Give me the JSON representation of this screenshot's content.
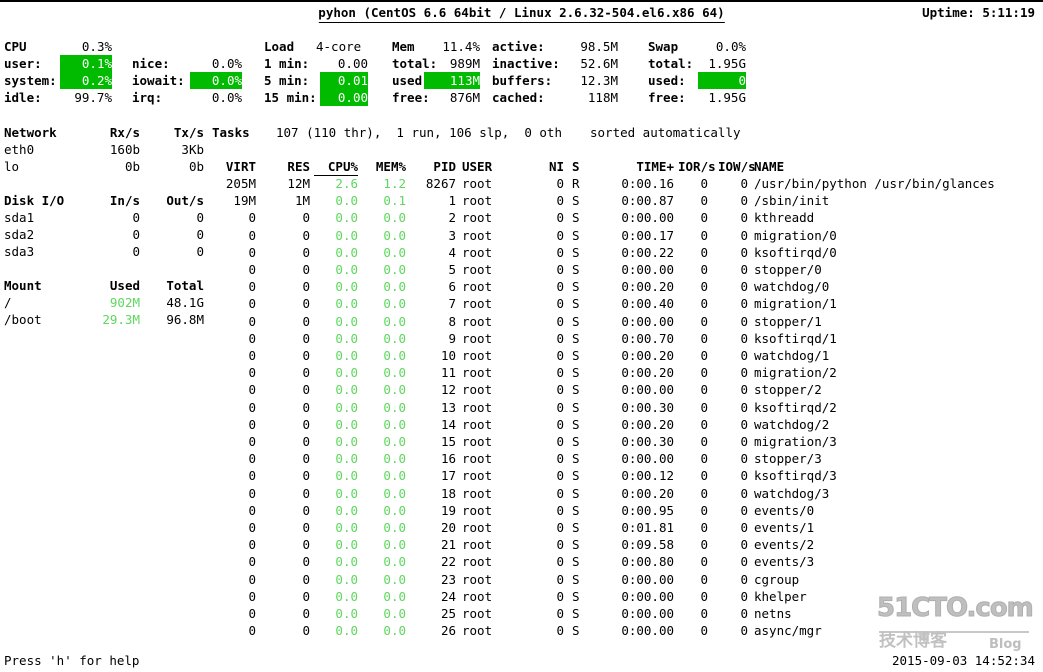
{
  "header": {
    "title": "pyhon (CentOS 6.6 64bit / Linux 2.6.32-504.el6.x86 64)",
    "uptime_label": "Uptime: 5:11:19"
  },
  "cpu": {
    "title": "CPU",
    "total": "0.3%",
    "rows": [
      {
        "label": "user:",
        "value": "0.1%",
        "highlight": true
      },
      {
        "label": "system:",
        "value": "0.2%",
        "highlight": true
      },
      {
        "label": "idle:",
        "value": "99.7%",
        "highlight": false
      }
    ],
    "rows2": [
      {
        "label": "nice:",
        "value": "0.0%",
        "highlight": false
      },
      {
        "label": "iowait:",
        "value": "0.0%",
        "highlight": true
      },
      {
        "label": "irq:",
        "value": "0.0%",
        "highlight": false
      }
    ]
  },
  "load": {
    "title": "Load",
    "cores": "4-core",
    "rows": [
      {
        "label": "1 min:",
        "value": "0.00",
        "highlight": false
      },
      {
        "label": "5 min:",
        "value": "0.01",
        "highlight": true
      },
      {
        "label": "15 min:",
        "value": "0.00",
        "highlight": true
      }
    ]
  },
  "mem": {
    "title": "Mem",
    "percent": "11.4%",
    "rows": [
      {
        "label": "total:",
        "value": "989M",
        "highlight": false
      },
      {
        "label": "used:",
        "value": "113M",
        "highlight": true
      },
      {
        "label": "free:",
        "value": "876M",
        "highlight": false
      }
    ],
    "rows2": [
      {
        "label": "active:",
        "value": "98.5M",
        "highlight": false
      },
      {
        "label": "inactive:",
        "value": "52.6M",
        "highlight": false
      },
      {
        "label": "buffers:",
        "value": "12.3M",
        "highlight": false
      },
      {
        "label": "cached:",
        "value": "118M",
        "highlight": false
      }
    ]
  },
  "swap": {
    "title": "Swap",
    "percent": "0.0%",
    "rows": [
      {
        "label": "total:",
        "value": "1.95G",
        "highlight": false
      },
      {
        "label": "used:",
        "value": "0",
        "highlight": true
      },
      {
        "label": "free:",
        "value": "1.95G",
        "highlight": false
      }
    ]
  },
  "network": {
    "title": "Network",
    "col_rx": "Rx/s",
    "col_tx": "Tx/s",
    "rows": [
      {
        "name": "eth0",
        "rx": "160b",
        "tx": "3Kb"
      },
      {
        "name": "lo",
        "rx": "0b",
        "tx": "0b"
      }
    ]
  },
  "diskio": {
    "title": "Disk I/O",
    "col_in": "In/s",
    "col_out": "Out/s",
    "rows": [
      {
        "name": "sda1",
        "in": "0",
        "out": "0"
      },
      {
        "name": "sda2",
        "in": "0",
        "out": "0"
      },
      {
        "name": "sda3",
        "in": "0",
        "out": "0"
      }
    ]
  },
  "mount": {
    "title": "Mount",
    "col_used": "Used",
    "col_total": "Total",
    "rows": [
      {
        "name": "/",
        "used": "902M",
        "total": "48.1G"
      },
      {
        "name": "/boot",
        "used": "29.3M",
        "total": "96.8M"
      }
    ]
  },
  "tasks": {
    "title": "Tasks",
    "summary": "107 (110 thr),  1 run, 106 slp,  0 oth",
    "sort_note": "sorted automatically"
  },
  "process_table": {
    "columns": [
      "VIRT",
      "RES",
      "CPU%",
      "MEM%",
      "PID",
      "USER",
      "NI",
      "S",
      "TIME+",
      "IOR/s",
      "IOW/s",
      "NAME"
    ],
    "sort_column": "CPU%",
    "rows": [
      {
        "virt": "205M",
        "res": "12M",
        "cpu": "2.6",
        "mem": "1.2",
        "pid": "8267",
        "user": "root",
        "ni": "0",
        "s": "R",
        "time": "0:00.16",
        "ior": "0",
        "iow": "0",
        "name": "/usr/bin/python /usr/bin/glances"
      },
      {
        "virt": "19M",
        "res": "1M",
        "cpu": "0.0",
        "mem": "0.1",
        "pid": "1",
        "user": "root",
        "ni": "0",
        "s": "S",
        "time": "0:00.87",
        "ior": "0",
        "iow": "0",
        "name": "/sbin/init"
      },
      {
        "virt": "0",
        "res": "0",
        "cpu": "0.0",
        "mem": "0.0",
        "pid": "2",
        "user": "root",
        "ni": "0",
        "s": "S",
        "time": "0:00.00",
        "ior": "0",
        "iow": "0",
        "name": "kthreadd"
      },
      {
        "virt": "0",
        "res": "0",
        "cpu": "0.0",
        "mem": "0.0",
        "pid": "3",
        "user": "root",
        "ni": "0",
        "s": "S",
        "time": "0:00.17",
        "ior": "0",
        "iow": "0",
        "name": "migration/0"
      },
      {
        "virt": "0",
        "res": "0",
        "cpu": "0.0",
        "mem": "0.0",
        "pid": "4",
        "user": "root",
        "ni": "0",
        "s": "S",
        "time": "0:00.22",
        "ior": "0",
        "iow": "0",
        "name": "ksoftirqd/0"
      },
      {
        "virt": "0",
        "res": "0",
        "cpu": "0.0",
        "mem": "0.0",
        "pid": "5",
        "user": "root",
        "ni": "0",
        "s": "S",
        "time": "0:00.00",
        "ior": "0",
        "iow": "0",
        "name": "stopper/0"
      },
      {
        "virt": "0",
        "res": "0",
        "cpu": "0.0",
        "mem": "0.0",
        "pid": "6",
        "user": "root",
        "ni": "0",
        "s": "S",
        "time": "0:00.20",
        "ior": "0",
        "iow": "0",
        "name": "watchdog/0"
      },
      {
        "virt": "0",
        "res": "0",
        "cpu": "0.0",
        "mem": "0.0",
        "pid": "7",
        "user": "root",
        "ni": "0",
        "s": "S",
        "time": "0:00.40",
        "ior": "0",
        "iow": "0",
        "name": "migration/1"
      },
      {
        "virt": "0",
        "res": "0",
        "cpu": "0.0",
        "mem": "0.0",
        "pid": "8",
        "user": "root",
        "ni": "0",
        "s": "S",
        "time": "0:00.00",
        "ior": "0",
        "iow": "0",
        "name": "stopper/1"
      },
      {
        "virt": "0",
        "res": "0",
        "cpu": "0.0",
        "mem": "0.0",
        "pid": "9",
        "user": "root",
        "ni": "0",
        "s": "S",
        "time": "0:00.70",
        "ior": "0",
        "iow": "0",
        "name": "ksoftirqd/1"
      },
      {
        "virt": "0",
        "res": "0",
        "cpu": "0.0",
        "mem": "0.0",
        "pid": "10",
        "user": "root",
        "ni": "0",
        "s": "S",
        "time": "0:00.20",
        "ior": "0",
        "iow": "0",
        "name": "watchdog/1"
      },
      {
        "virt": "0",
        "res": "0",
        "cpu": "0.0",
        "mem": "0.0",
        "pid": "11",
        "user": "root",
        "ni": "0",
        "s": "S",
        "time": "0:00.20",
        "ior": "0",
        "iow": "0",
        "name": "migration/2"
      },
      {
        "virt": "0",
        "res": "0",
        "cpu": "0.0",
        "mem": "0.0",
        "pid": "12",
        "user": "root",
        "ni": "0",
        "s": "S",
        "time": "0:00.00",
        "ior": "0",
        "iow": "0",
        "name": "stopper/2"
      },
      {
        "virt": "0",
        "res": "0",
        "cpu": "0.0",
        "mem": "0.0",
        "pid": "13",
        "user": "root",
        "ni": "0",
        "s": "S",
        "time": "0:00.30",
        "ior": "0",
        "iow": "0",
        "name": "ksoftirqd/2"
      },
      {
        "virt": "0",
        "res": "0",
        "cpu": "0.0",
        "mem": "0.0",
        "pid": "14",
        "user": "root",
        "ni": "0",
        "s": "S",
        "time": "0:00.20",
        "ior": "0",
        "iow": "0",
        "name": "watchdog/2"
      },
      {
        "virt": "0",
        "res": "0",
        "cpu": "0.0",
        "mem": "0.0",
        "pid": "15",
        "user": "root",
        "ni": "0",
        "s": "S",
        "time": "0:00.30",
        "ior": "0",
        "iow": "0",
        "name": "migration/3"
      },
      {
        "virt": "0",
        "res": "0",
        "cpu": "0.0",
        "mem": "0.0",
        "pid": "16",
        "user": "root",
        "ni": "0",
        "s": "S",
        "time": "0:00.00",
        "ior": "0",
        "iow": "0",
        "name": "stopper/3"
      },
      {
        "virt": "0",
        "res": "0",
        "cpu": "0.0",
        "mem": "0.0",
        "pid": "17",
        "user": "root",
        "ni": "0",
        "s": "S",
        "time": "0:00.12",
        "ior": "0",
        "iow": "0",
        "name": "ksoftirqd/3"
      },
      {
        "virt": "0",
        "res": "0",
        "cpu": "0.0",
        "mem": "0.0",
        "pid": "18",
        "user": "root",
        "ni": "0",
        "s": "S",
        "time": "0:00.20",
        "ior": "0",
        "iow": "0",
        "name": "watchdog/3"
      },
      {
        "virt": "0",
        "res": "0",
        "cpu": "0.0",
        "mem": "0.0",
        "pid": "19",
        "user": "root",
        "ni": "0",
        "s": "S",
        "time": "0:00.95",
        "ior": "0",
        "iow": "0",
        "name": "events/0"
      },
      {
        "virt": "0",
        "res": "0",
        "cpu": "0.0",
        "mem": "0.0",
        "pid": "20",
        "user": "root",
        "ni": "0",
        "s": "S",
        "time": "0:01.81",
        "ior": "0",
        "iow": "0",
        "name": "events/1"
      },
      {
        "virt": "0",
        "res": "0",
        "cpu": "0.0",
        "mem": "0.0",
        "pid": "21",
        "user": "root",
        "ni": "0",
        "s": "S",
        "time": "0:09.58",
        "ior": "0",
        "iow": "0",
        "name": "events/2"
      },
      {
        "virt": "0",
        "res": "0",
        "cpu": "0.0",
        "mem": "0.0",
        "pid": "22",
        "user": "root",
        "ni": "0",
        "s": "S",
        "time": "0:00.80",
        "ior": "0",
        "iow": "0",
        "name": "events/3"
      },
      {
        "virt": "0",
        "res": "0",
        "cpu": "0.0",
        "mem": "0.0",
        "pid": "23",
        "user": "root",
        "ni": "0",
        "s": "S",
        "time": "0:00.00",
        "ior": "0",
        "iow": "0",
        "name": "cgroup"
      },
      {
        "virt": "0",
        "res": "0",
        "cpu": "0.0",
        "mem": "0.0",
        "pid": "24",
        "user": "root",
        "ni": "0",
        "s": "S",
        "time": "0:00.00",
        "ior": "0",
        "iow": "0",
        "name": "khelper"
      },
      {
        "virt": "0",
        "res": "0",
        "cpu": "0.0",
        "mem": "0.0",
        "pid": "25",
        "user": "root",
        "ni": "0",
        "s": "S",
        "time": "0:00.00",
        "ior": "0",
        "iow": "0",
        "name": "netns"
      },
      {
        "virt": "0",
        "res": "0",
        "cpu": "0.0",
        "mem": "0.0",
        "pid": "26",
        "user": "root",
        "ni": "0",
        "s": "S",
        "time": "0:00.00",
        "ior": "0",
        "iow": "0",
        "name": "async/mgr"
      }
    ]
  },
  "statusbar": {
    "help": "Press 'h' for help",
    "datetime": "2015-09-03 14:52:34"
  },
  "watermark": {
    "main": "51CTO.com",
    "cn": "技术博客",
    "blog": "Blog"
  },
  "colors": {
    "highlight_bg": "#00bb00",
    "highlight_fg": "#ffffff",
    "value_green": "#5fd75f",
    "text": "#000000",
    "background": "#ffffff"
  }
}
